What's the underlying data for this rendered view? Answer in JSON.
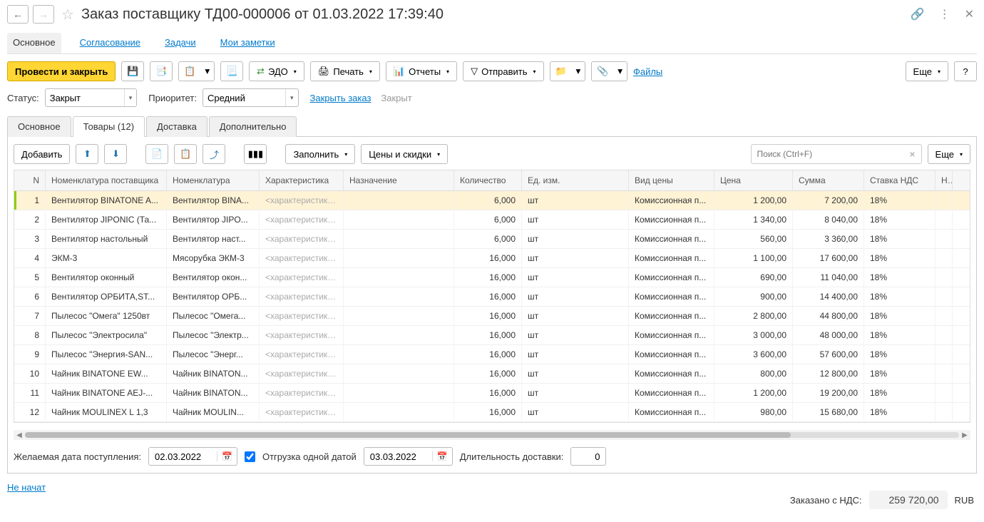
{
  "header": {
    "title": "Заказ поставщику ТД00-000006 от 01.03.2022 17:39:40"
  },
  "sectionTabs": {
    "main": "Основное",
    "approval": "Согласование",
    "tasks": "Задачи",
    "notes": "Мои заметки"
  },
  "toolbar": {
    "submitClose": "Провести и закрыть",
    "edo": "ЭДО",
    "print": "Печать",
    "reports": "Отчеты",
    "send": "Отправить",
    "files": "Файлы",
    "more": "Еще"
  },
  "filters": {
    "statusLabel": "Статус:",
    "statusValue": "Закрыт",
    "priorityLabel": "Приоритет:",
    "priorityValue": "Средний",
    "closeOrder": "Закрыть заказ",
    "closed": "Закрыт"
  },
  "docTabs": {
    "main": "Основное",
    "goods": "Товары (12)",
    "delivery": "Доставка",
    "extra": "Дополнительно"
  },
  "tableToolbar": {
    "add": "Добавить",
    "fill": "Заполнить",
    "priceDiscount": "Цены и скидки",
    "searchPlaceholder": "Поиск (Ctrl+F)",
    "more": "Еще"
  },
  "columns": {
    "n": "N",
    "supplierNom": "Номенклатура поставщика",
    "nom": "Номенклатура",
    "char": "Характеристика",
    "assign": "Назначение",
    "qty": "Количество",
    "unit": "Ед. изм.",
    "ptype": "Вид цены",
    "price": "Цена",
    "sum": "Сумма",
    "vat": "Ставка НДС",
    "last": "Н"
  },
  "charPlaceholder": "<характеристики...",
  "rows": [
    {
      "n": "1",
      "supplierNom": "Вентилятор BINATONE A...",
      "nom": "Вентилятор BINA...",
      "qty": "6,000",
      "unit": "шт",
      "ptype": "Комиссионная п...",
      "price": "1 200,00",
      "sum": "7 200,00",
      "vat": "18%"
    },
    {
      "n": "2",
      "supplierNom": "Вентилятор JIPONIC (Та...",
      "nom": "Вентилятор JIPO...",
      "qty": "6,000",
      "unit": "шт",
      "ptype": "Комиссионная п...",
      "price": "1 340,00",
      "sum": "8 040,00",
      "vat": "18%"
    },
    {
      "n": "3",
      "supplierNom": "Вентилятор настольный",
      "nom": "Вентилятор наст...",
      "qty": "6,000",
      "unit": "шт",
      "ptype": "Комиссионная п...",
      "price": "560,00",
      "sum": "3 360,00",
      "vat": "18%"
    },
    {
      "n": "4",
      "supplierNom": "ЭКМ-3",
      "nom": "Мясорубка ЭКМ-3",
      "qty": "16,000",
      "unit": "шт",
      "ptype": "Комиссионная п...",
      "price": "1 100,00",
      "sum": "17 600,00",
      "vat": "18%"
    },
    {
      "n": "5",
      "supplierNom": "Вентилятор оконный",
      "nom": "Вентилятор окон...",
      "qty": "16,000",
      "unit": "шт",
      "ptype": "Комиссионная п...",
      "price": "690,00",
      "sum": "11 040,00",
      "vat": "18%"
    },
    {
      "n": "6",
      "supplierNom": "Вентилятор ОРБИТА,ST...",
      "nom": "Вентилятор ОРБ...",
      "qty": "16,000",
      "unit": "шт",
      "ptype": "Комиссионная п...",
      "price": "900,00",
      "sum": "14 400,00",
      "vat": "18%"
    },
    {
      "n": "7",
      "supplierNom": "Пылесос \"Омега\" 1250вт",
      "nom": "Пылесос \"Омега...",
      "qty": "16,000",
      "unit": "шт",
      "ptype": "Комиссионная п...",
      "price": "2 800,00",
      "sum": "44 800,00",
      "vat": "18%"
    },
    {
      "n": "8",
      "supplierNom": "Пылесос \"Электросила\"",
      "nom": "Пылесос \"Электр...",
      "qty": "16,000",
      "unit": "шт",
      "ptype": "Комиссионная п...",
      "price": "3 000,00",
      "sum": "48 000,00",
      "vat": "18%"
    },
    {
      "n": "9",
      "supplierNom": "Пылесос \"Энергия-SAN...",
      "nom": "Пылесос \"Энерг...",
      "qty": "16,000",
      "unit": "шт",
      "ptype": "Комиссионная п...",
      "price": "3 600,00",
      "sum": "57 600,00",
      "vat": "18%"
    },
    {
      "n": "10",
      "supplierNom": "Чайник BINATONE  EW...",
      "nom": "Чайник BINATON...",
      "qty": "16,000",
      "unit": "шт",
      "ptype": "Комиссионная п...",
      "price": "800,00",
      "sum": "12 800,00",
      "vat": "18%"
    },
    {
      "n": "11",
      "supplierNom": "Чайник BINATONE  AEJ-...",
      "nom": "Чайник BINATON...",
      "qty": "16,000",
      "unit": "шт",
      "ptype": "Комиссионная п...",
      "price": "1 200,00",
      "sum": "19 200,00",
      "vat": "18%"
    },
    {
      "n": "12",
      "supplierNom": "Чайник MOULINEX L 1,3",
      "nom": "Чайник MOULIN...",
      "qty": "16,000",
      "unit": "шт",
      "ptype": "Комиссионная п...",
      "price": "980,00",
      "sum": "15 680,00",
      "vat": "18%"
    }
  ],
  "footer": {
    "desiredDateLabel": "Желаемая дата поступления:",
    "desiredDate": "02.03.2022",
    "shipOneDate": "Отгрузка одной датой",
    "shipDate": "03.03.2022",
    "durationLabel": "Длительность доставки:",
    "durationValue": "0"
  },
  "status": {
    "notStarted": "Не начат"
  },
  "totals": {
    "label": "Заказано с НДС:",
    "value": "259 720,00",
    "currency": "RUB"
  }
}
